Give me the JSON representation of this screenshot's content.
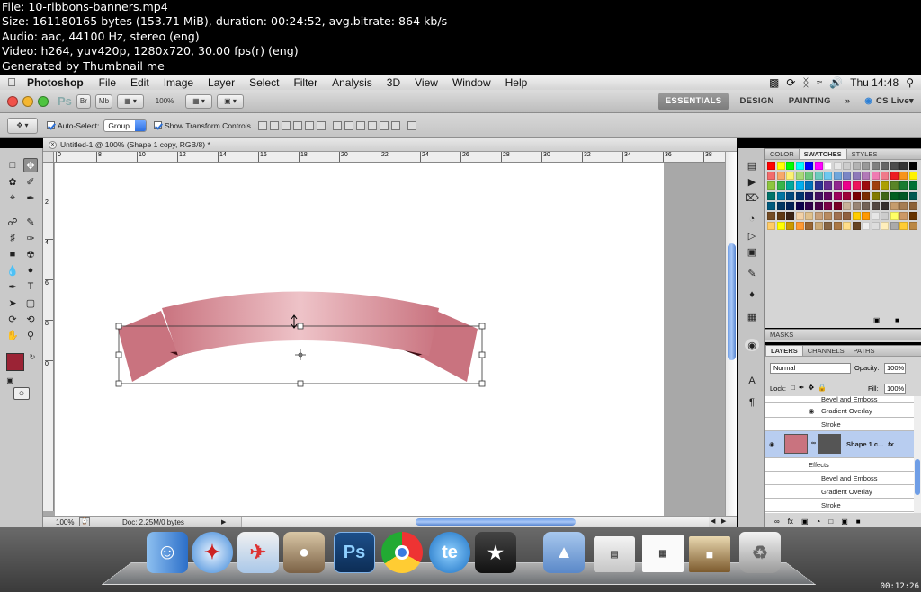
{
  "info": {
    "lines": [
      "File: 10-ribbons-banners.mp4",
      "Size: 161180165 bytes (153.71 MiB), duration: 00:24:52, avg.bitrate: 864 kb/s",
      "Audio: aac, 44100 Hz, stereo (eng)",
      "Video: h264, yuv420p, 1280x720, 30.00 fps(r) (eng)",
      "Generated by Thumbnail me"
    ]
  },
  "menubar": {
    "app": "Photoshop",
    "items": [
      "File",
      "Edit",
      "Image",
      "Layer",
      "Select",
      "Filter",
      "Analysis",
      "3D",
      "View",
      "Window",
      "Help"
    ],
    "clock": "Thu 14:48"
  },
  "apptool": {
    "zoom": "100%",
    "workspaces": [
      "ESSENTIALS",
      "DESIGN",
      "PAINTING"
    ],
    "cslive": "CS Live"
  },
  "options": {
    "auto_select": "Auto-Select:",
    "group": "Group",
    "transform": "Show Transform Controls"
  },
  "document": {
    "tab": "Untitled-1 @ 100% (Shape 1 copy, RGB/8) *",
    "zoom": "100%",
    "doc_size": "Doc: 2.25M/0 bytes",
    "ruler_h": [
      "0",
      "8",
      "10",
      "12",
      "14",
      "16",
      "18",
      "20",
      "22",
      "24",
      "26",
      "28",
      "30",
      "32",
      "34",
      "36",
      "38"
    ],
    "ruler_v": [
      "2",
      "4",
      "6",
      "8",
      "0"
    ]
  },
  "panels": {
    "color_tabs": [
      "COLOR",
      "SWATCHES",
      "STYLES"
    ],
    "masks": "MASKS",
    "layer_tabs": [
      "LAYERS",
      "CHANNELS",
      "PATHS"
    ],
    "blend": "Normal",
    "opacity_label": "Opacity:",
    "opacity": "100%",
    "lock": "Lock:",
    "fill_label": "Fill:",
    "fill": "100%",
    "layers": [
      "Bevel and Emboss",
      "Gradient Overlay",
      "Stroke",
      "Shape 1 c...",
      "Effects",
      "Bevel and Emboss",
      "Gradient Overlay",
      "Stroke"
    ]
  },
  "colors": {
    "ribbon_light": "#eec3c8",
    "ribbon_dark": "#c9737f",
    "ribbon_fold": "#3e0d13",
    "foreground": "#9b2335"
  },
  "timer": "00:12:26"
}
